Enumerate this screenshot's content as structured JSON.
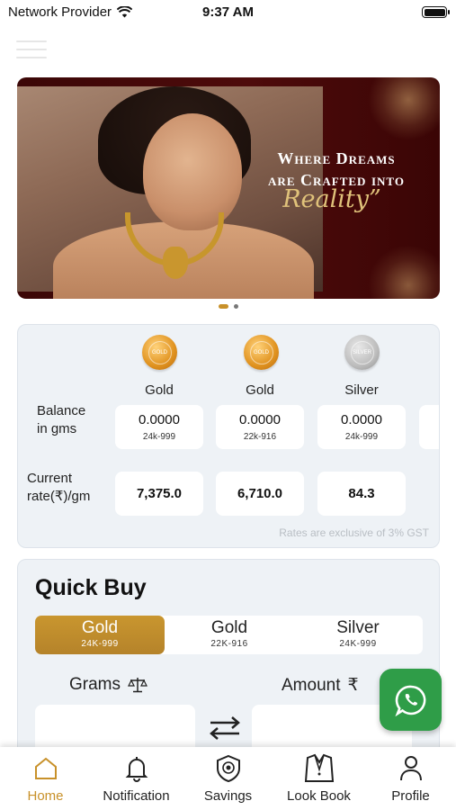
{
  "status_bar": {
    "carrier": "Network Provider",
    "time": "9:37 AM"
  },
  "banner": {
    "line1": "Where Dreams",
    "line2": "are Crafted into",
    "script_text": "Reality",
    "slide_count": 2,
    "active_slide": 1
  },
  "rates": {
    "metals": [
      {
        "name": "Gold",
        "coin_label": "GOLD",
        "balance": "0.0000",
        "purity": "24k-999",
        "rate": "7,375.0"
      },
      {
        "name": "Gold",
        "coin_label": "GOLD",
        "balance": "0.0000",
        "purity": "22k-916",
        "rate": "6,710.0"
      },
      {
        "name": "Silver",
        "coin_label": "SILVER",
        "balance": "0.0000",
        "purity": "24k-999",
        "rate": "84.3"
      }
    ],
    "balance_label_1": "Balance",
    "balance_label_2": "in gms",
    "rate_label_1": "Current",
    "rate_label_2": "rate(₹)/gm",
    "gst_note": "Rates are exclusive of 3% GST"
  },
  "quick_buy": {
    "title": "Quick Buy",
    "options": [
      {
        "name": "Gold",
        "purity": "24K-999",
        "active": true
      },
      {
        "name": "Gold",
        "purity": "22K-916",
        "active": false
      },
      {
        "name": "Silver",
        "purity": "24K-999",
        "active": false
      }
    ],
    "grams_label": "Grams",
    "amount_label": "Amount",
    "grams_value": "",
    "amount_value": ""
  },
  "bottom_nav": [
    {
      "label": "Home",
      "icon": "home-icon",
      "active": true
    },
    {
      "label": "Notification",
      "icon": "bell-icon",
      "active": false
    },
    {
      "label": "Savings",
      "icon": "savings-icon",
      "active": false
    },
    {
      "label": "Look Book",
      "icon": "lookbook-icon",
      "active": false
    },
    {
      "label": "Profile",
      "icon": "profile-icon",
      "active": false
    }
  ],
  "colors": {
    "accent": "#c8912a",
    "whatsapp": "#2f9d48",
    "banner_bg": "#4e0b0b"
  }
}
